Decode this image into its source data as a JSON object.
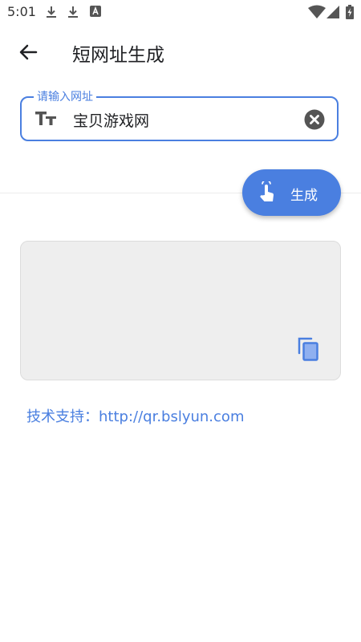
{
  "status_bar": {
    "time": "5:01",
    "icons": [
      "download-icon",
      "download-icon",
      "font-a-icon",
      "wifi-icon",
      "signal-icon",
      "battery-charging-icon"
    ]
  },
  "app_bar": {
    "title": "短网址生成"
  },
  "url_input": {
    "label": "请输入网址",
    "value": "宝贝游戏网"
  },
  "generate_button": {
    "label": "生成"
  },
  "result_card": {
    "text": ""
  },
  "footer": {
    "support_text": "技术支持：http://qr.bslyun.com"
  },
  "colors": {
    "accent": "#4a7fe0",
    "card_bg": "#eeeeee"
  }
}
